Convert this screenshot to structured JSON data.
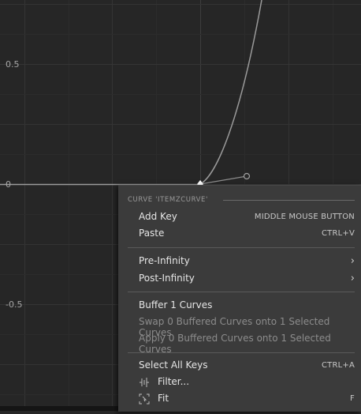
{
  "graph": {
    "y_labels": [
      "0.5",
      "0",
      "-0.5"
    ],
    "colors": {
      "background": "#262626",
      "grid": "#333333",
      "curve": "#9a9a9a"
    }
  },
  "menu": {
    "header": "CURVE 'ITEMZCURVE'",
    "items": {
      "add_key": {
        "label": "Add Key",
        "shortcut": "MIDDLE MOUSE BUTTON"
      },
      "paste": {
        "label": "Paste",
        "shortcut": "CTRL+V"
      },
      "pre_infinity": {
        "label": "Pre-Infinity"
      },
      "post_infinity": {
        "label": "Post-Infinity"
      },
      "buffer_curves": {
        "label": "Buffer 1 Curves"
      },
      "swap_curves": {
        "label": "Swap 0 Buffered Curves onto 1 Selected Curves"
      },
      "apply_curves": {
        "label": "Apply 0 Buffered Curves onto 1 Selected Curves"
      },
      "select_all_keys": {
        "label": "Select All Keys",
        "shortcut": "CTRL+A"
      },
      "filter": {
        "label": "Filter..."
      },
      "fit": {
        "label": "Fit",
        "shortcut": "F"
      }
    },
    "submenu_arrow": "›"
  }
}
